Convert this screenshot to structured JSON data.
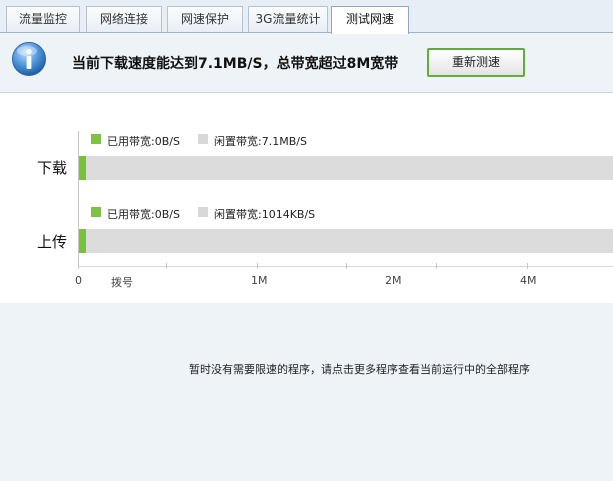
{
  "tabs": [
    {
      "label": "流量监控"
    },
    {
      "label": "网络连接"
    },
    {
      "label": "网速保护"
    },
    {
      "label": "3G流量统计"
    },
    {
      "label": "测试网速",
      "active": true
    }
  ],
  "banner": {
    "icon": "info-icon",
    "message": "当前下载速度能达到7.1MB/S，总带宽超过8M宽带",
    "retest_label": "重新测速"
  },
  "colors": {
    "used": "#78c23a",
    "idle": "#dcdcdc",
    "button_border": "#5fae39",
    "panel_bg": "#eef3f8"
  },
  "chart_data": {
    "type": "bar",
    "orientation": "horizontal",
    "categories": [
      "下载",
      "上传"
    ],
    "series": [
      {
        "name": "已用带宽",
        "values": [
          0,
          0
        ]
      },
      {
        "name": "闲置带宽",
        "values": [
          7.1,
          1014
        ]
      }
    ],
    "legends": {
      "download": {
        "used": "已用带宽:0B/S",
        "idle": "闲置带宽:7.1MB/S"
      },
      "upload": {
        "used": "已用带宽:0B/S",
        "idle": "闲置带宽:1014KB/S"
      }
    },
    "x_ticks": [
      "0",
      "拨号",
      "1M",
      "2M",
      "4M"
    ],
    "grid": false
  },
  "process": {
    "empty_message": "暂时没有需要限速的程序，请点击更多程序查看当前运行中的全部程序"
  }
}
